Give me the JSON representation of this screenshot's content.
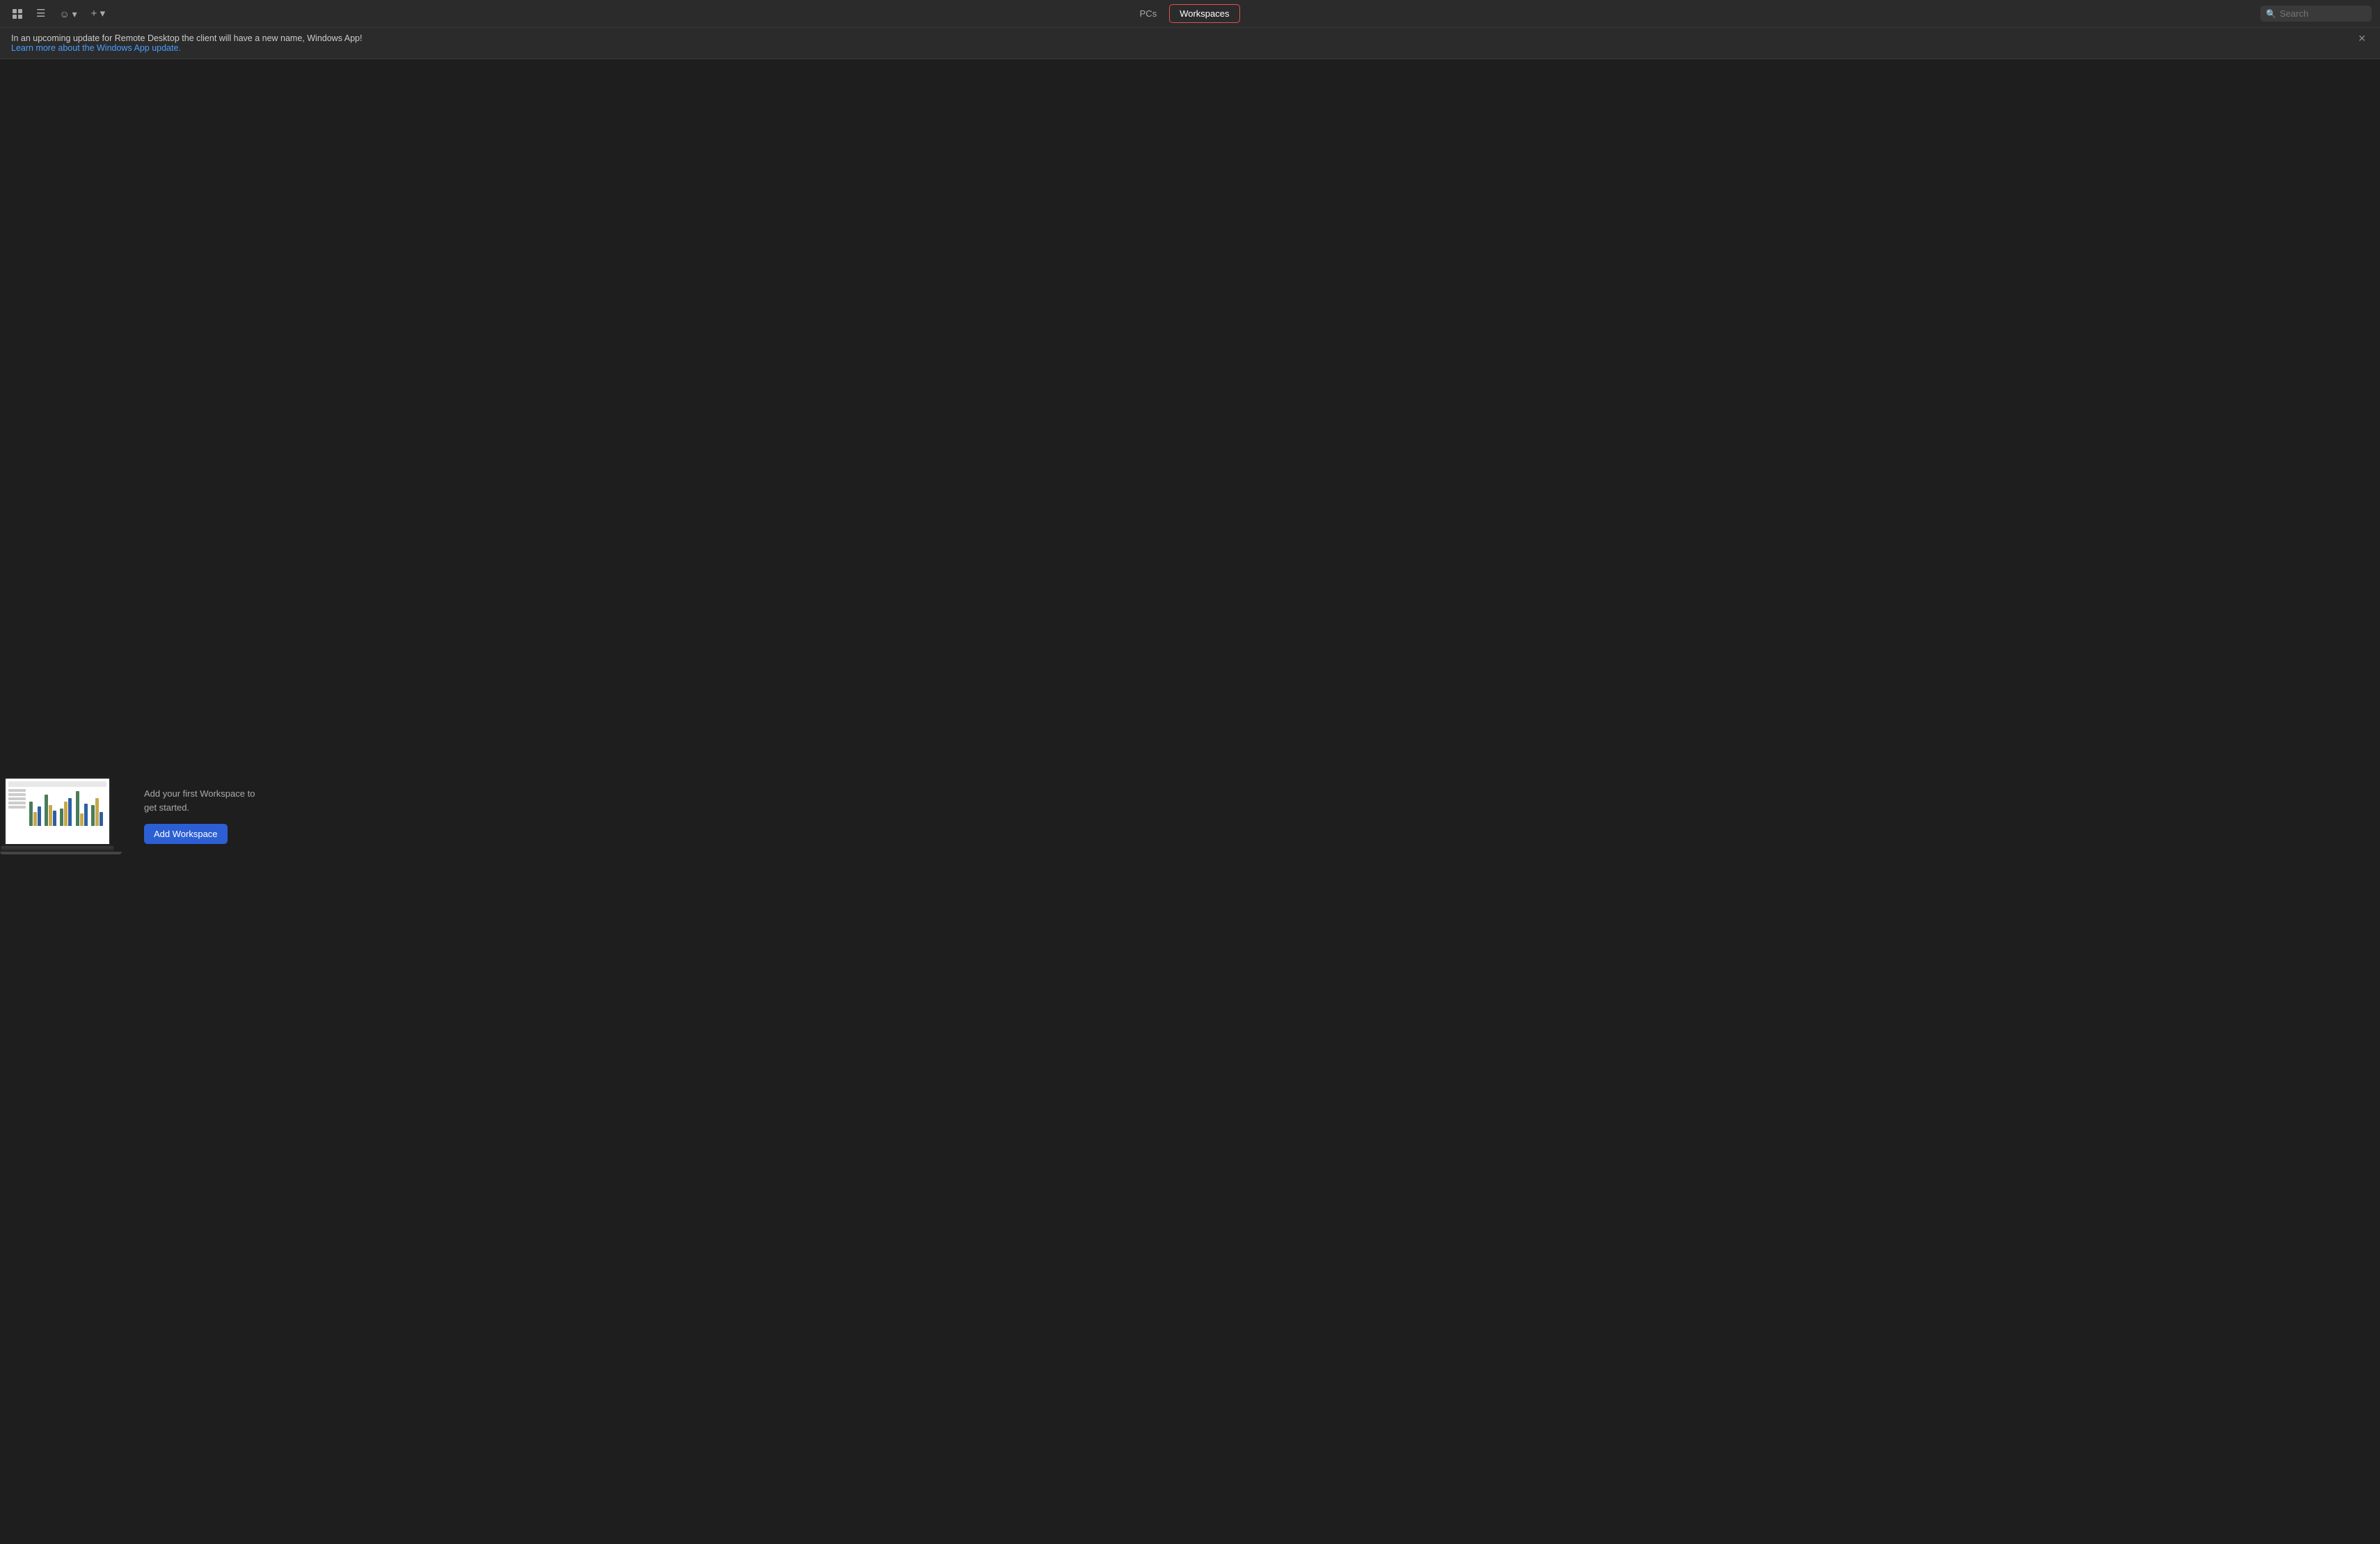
{
  "toolbar": {
    "pcs_tab_label": "PCs",
    "workspaces_tab_label": "Workspaces",
    "search_placeholder": "Search",
    "active_tab": "workspaces"
  },
  "notification": {
    "message": "In an upcoming update for Remote Desktop the client will have a new name, Windows App!",
    "link_text": "Learn more about the Windows App update.",
    "link_href": "#"
  },
  "empty_state": {
    "description": "Add your first Workspace to get started.",
    "add_button_label": "Add Workspace"
  },
  "chart": {
    "bar_groups": [
      {
        "bars": [
          {
            "color": "#4a7c59",
            "height": 35
          },
          {
            "color": "#c8a84b",
            "height": 20
          },
          {
            "color": "#2e5fa3",
            "height": 28
          }
        ]
      },
      {
        "bars": [
          {
            "color": "#4a7c59",
            "height": 45
          },
          {
            "color": "#c8a84b",
            "height": 30
          },
          {
            "color": "#2e5fa3",
            "height": 22
          }
        ]
      },
      {
        "bars": [
          {
            "color": "#4a7c59",
            "height": 25
          },
          {
            "color": "#c8a84b",
            "height": 35
          },
          {
            "color": "#2e5fa3",
            "height": 40
          }
        ]
      },
      {
        "bars": [
          {
            "color": "#4a7c59",
            "height": 50
          },
          {
            "color": "#c8a84b",
            "height": 18
          },
          {
            "color": "#2e5fa3",
            "height": 32
          }
        ]
      },
      {
        "bars": [
          {
            "color": "#4a7c59",
            "height": 30
          },
          {
            "color": "#c8a84b",
            "height": 40
          },
          {
            "color": "#2e5fa3",
            "height": 20
          }
        ]
      }
    ]
  }
}
